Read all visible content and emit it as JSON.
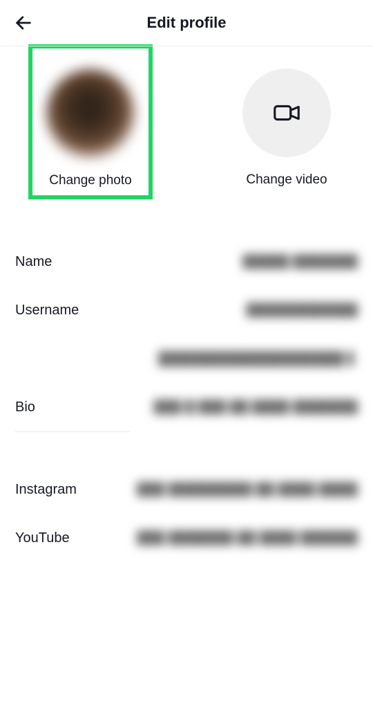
{
  "header": {
    "title": "Edit profile"
  },
  "media": {
    "change_photo_label": "Change photo",
    "change_video_label": "Change video"
  },
  "fields": {
    "name_label": "Name",
    "name_value": "█████ ███████",
    "username_label": "Username",
    "username_value": "████████████",
    "profile_link_value": "████████████████████ ▋",
    "bio_label": "Bio",
    "bio_value": "███ █ ███ ██ ████ ███████"
  },
  "social": {
    "instagram_label": "Instagram",
    "instagram_value": "███ █████████ ██ ████ ███████",
    "youtube_label": "YouTube",
    "youtube_value": "███ ███████ ██ ████ ███████"
  }
}
